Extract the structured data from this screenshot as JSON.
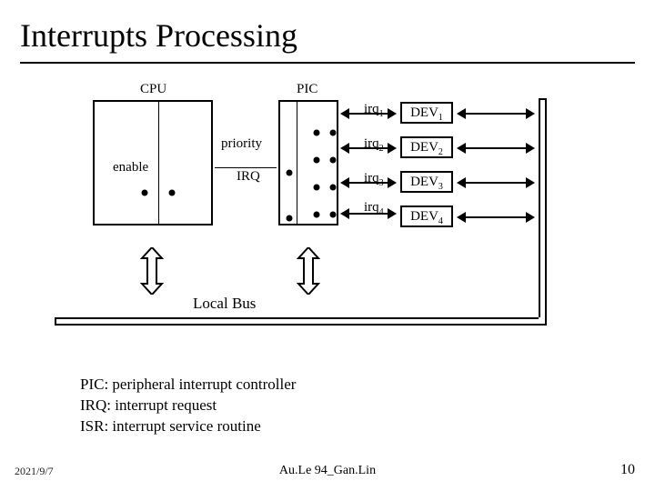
{
  "title": "Interrupts Processing",
  "labels": {
    "cpu": "CPU",
    "pic": "PIC",
    "enable": "enable",
    "priority": "priority",
    "irq": "IRQ",
    "irq1": "irq",
    "irq2": "irq",
    "irq3": "irq",
    "irq4": "irq",
    "dev1": "DEV",
    "dev2": "DEV",
    "dev3": "DEV",
    "dev4": "DEV",
    "local_bus": "Local Bus"
  },
  "sub": {
    "s1": "1",
    "s2": "2",
    "s3": "3",
    "s4": "4"
  },
  "glossary": {
    "line1": "PIC: peripheral interrupt controller",
    "line2": "IRQ: interrupt request",
    "line3": "ISR: interrupt service routine"
  },
  "footer": {
    "date": "2021/9/7",
    "center": "Au.Le 94_Gan.Lin",
    "page": "10"
  }
}
